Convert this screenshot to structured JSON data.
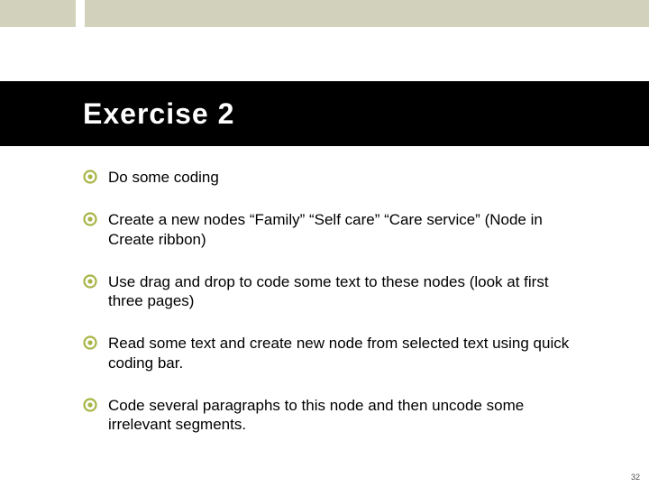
{
  "colors": {
    "top_band": "#d2d2bc",
    "title_band": "#000000",
    "title_text": "#ffffff",
    "bullet": "#a8b545",
    "body_text": "#000000"
  },
  "title": "Exercise 2",
  "items": [
    "Do some coding",
    "Create a new nodes “Family” “Self care” “Care service” (Node in Create ribbon)",
    "Use drag and drop to code some text to these nodes (look at first three pages)",
    "Read some text and create new node from selected text using quick coding bar.",
    "Code several paragraphs to this node and then uncode some irrelevant segments."
  ],
  "page_number": "32"
}
